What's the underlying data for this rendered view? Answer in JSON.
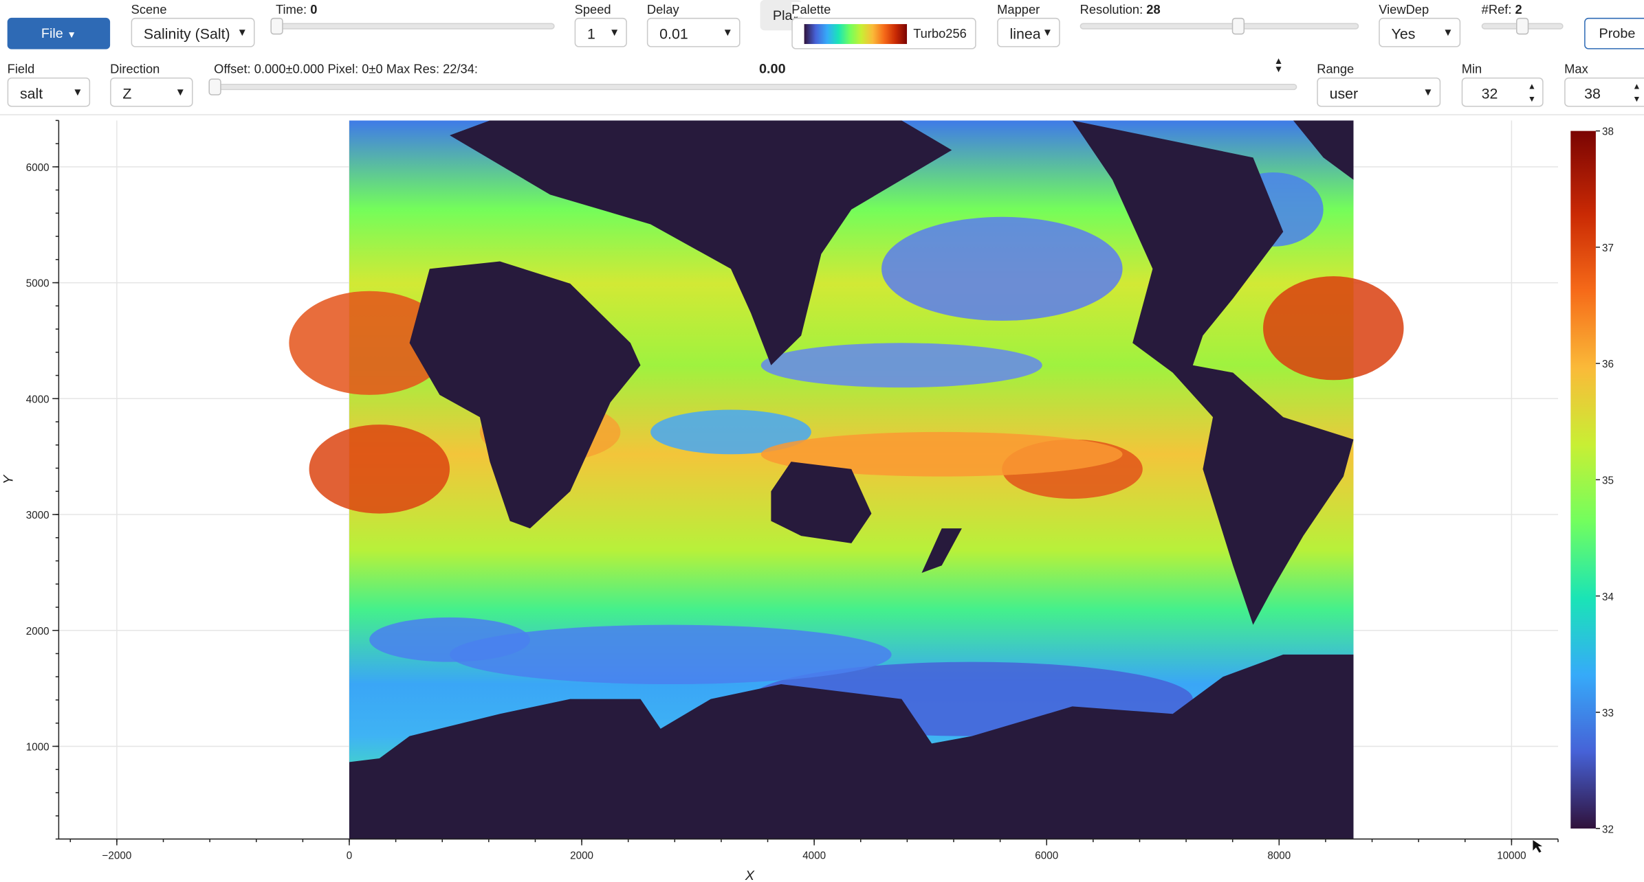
{
  "toolbar": {
    "file_label": "File",
    "scene": {
      "label": "Scene",
      "value": "Salinity (Salt)"
    },
    "time": {
      "label": "Time:",
      "value": "0",
      "level": 0.0
    },
    "speed": {
      "label": "Speed",
      "value": "1"
    },
    "delay": {
      "label": "Delay",
      "value": "0.01"
    },
    "play_label": "Play",
    "palette": {
      "label": "Palette",
      "value": "Turbo256"
    },
    "mapper": {
      "label": "Mapper",
      "value": "linea"
    },
    "resolution": {
      "label": "Resolution:",
      "value": "28",
      "level": 0.57
    },
    "viewdep": {
      "label": "ViewDep",
      "value": "Yes"
    },
    "nref": {
      "label": "#Ref:",
      "value": "2",
      "level": 0.5
    },
    "probe_label": "Probe"
  },
  "row2": {
    "field": {
      "label": "Field",
      "value": "salt"
    },
    "direction": {
      "label": "Direction",
      "value": "Z"
    },
    "offset_info": "Offset: 0.000±0.000 Pixel: 0±0 Max Res: 22/34:",
    "offset_value": "0.00",
    "offset_level": 0.0,
    "range": {
      "label": "Range",
      "value": "user"
    },
    "min": {
      "label": "Min",
      "value": "32"
    },
    "max": {
      "label": "Max",
      "value": "38"
    }
  },
  "plot": {
    "x_label": "X",
    "y_label": "Y",
    "x_ticks": [
      "−2000",
      "0",
      "2000",
      "4000",
      "6000",
      "8000",
      "10000"
    ],
    "y_ticks": [
      "1000",
      "2000",
      "3000",
      "4000",
      "5000",
      "6000"
    ],
    "colorbar_ticks": [
      "32",
      "33",
      "34",
      "35",
      "36",
      "37",
      "38"
    ],
    "land_color": "#271a3c",
    "palette_stops": [
      "#30123b",
      "#4662d7",
      "#36aaf9",
      "#1ae4b6",
      "#72fe5e",
      "#c8ef34",
      "#faba39",
      "#f66b19",
      "#ca2a04",
      "#7a0403"
    ]
  },
  "icons": [
    "caret-down-icon",
    "pan-icon",
    "box-zoom-icon",
    "wheel-zoom-icon",
    "reset-icon",
    "bokeh-logo-icon",
    "cursor-icon"
  ],
  "chart_data": {
    "type": "heatmap",
    "xlabel": "X",
    "ylabel": "Y",
    "xlim": [
      -2500,
      10400
    ],
    "ylim": [
      200,
      6400
    ],
    "data_extent_x": [
      0,
      8640
    ],
    "data_extent_y": [
      0,
      6400
    ],
    "color_range": [
      32,
      38
    ],
    "colorbar_ticks": [
      32,
      33,
      34,
      35,
      36,
      37,
      38
    ],
    "palette": "Turbo256",
    "grid": true
  }
}
